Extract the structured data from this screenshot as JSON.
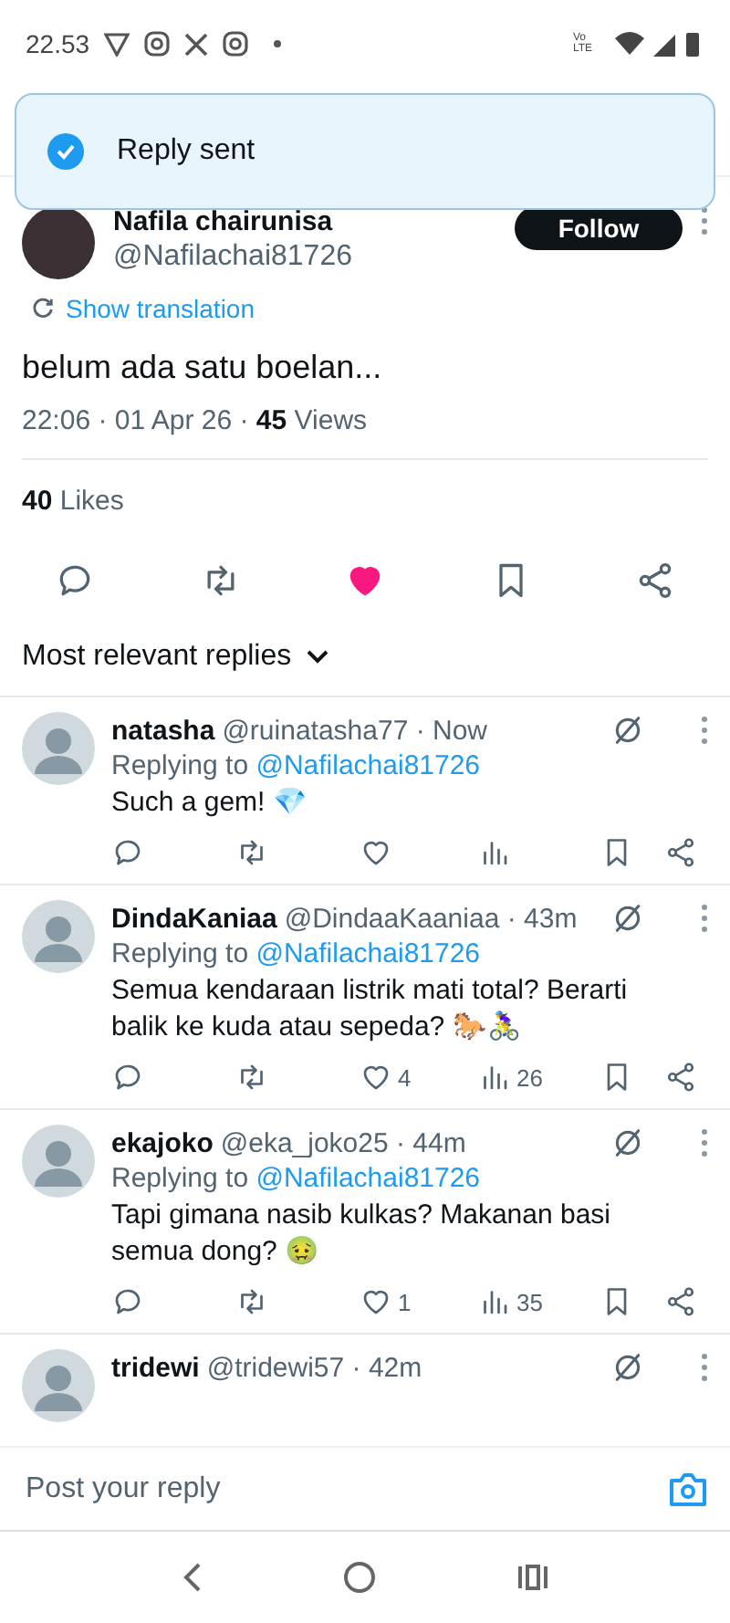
{
  "status_bar": {
    "time": "22.53",
    "network": "Vo LTE"
  },
  "toast": {
    "text": "Reply sent"
  },
  "post": {
    "author": "Nafila chairunisa",
    "handle": "@Nafilachai81726",
    "follow_label": "Follow",
    "translate_label": "Show translation",
    "text": "belum ada satu boelan...",
    "timestamp": "22:06 · 01 Apr 26 · ",
    "views_count": "45",
    "views_label": "Views",
    "likes_count": "40",
    "likes_label": "Likes",
    "liked": true,
    "bookmarked": false
  },
  "sort": {
    "label": "Most relevant replies"
  },
  "replies": [
    {
      "name": "natasha",
      "handle": "@ruinatasha77",
      "time": "· Now",
      "replying_label": "Replying to",
      "replying_to": "@Nafilachai81726",
      "text": "Such a gem! 💎"
    },
    {
      "name": "DindaKaniaa",
      "handle": "@DindaaKaaniaa",
      "time": "· 43m",
      "replying_label": "Replying to",
      "replying_to": "@Nafilachai81726",
      "text": "Semua kendaraan listrik mati total? Berarti balik ke kuda atau sepeda? 🐎🚴‍♀️",
      "likes": "4",
      "views": "26"
    },
    {
      "name": "ekajoko",
      "handle": "@eka_joko25",
      "time": "· 44m",
      "replying_label": "Replying to",
      "replying_to": "@Nafilachai81726",
      "text": "Tapi gimana nasib kulkas? Makanan basi semua dong? 🤢",
      "likes": "1",
      "views": "35"
    },
    {
      "name": "tridewi",
      "handle": "@tridewi57",
      "time": "· 42m"
    }
  ],
  "compose": {
    "placeholder": "Post your reply"
  }
}
